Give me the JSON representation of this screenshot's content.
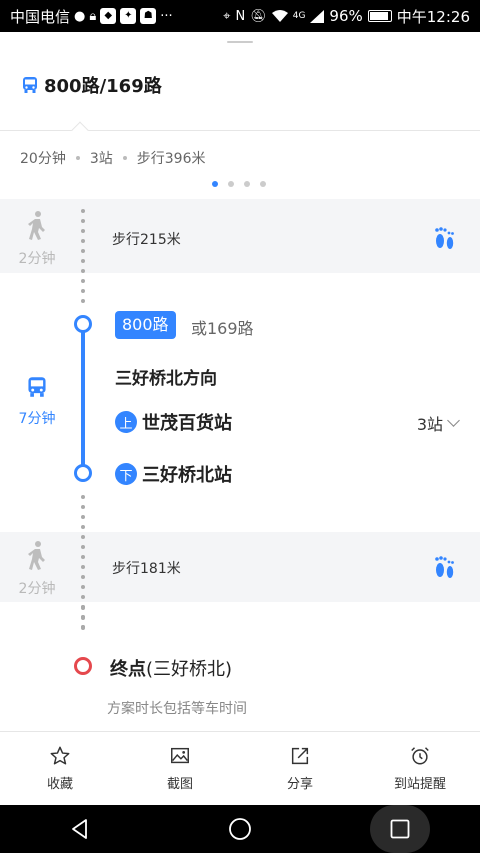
{
  "status_bar": {
    "carrier": "中国电信",
    "battery": "96%",
    "time": "中午12:26",
    "left_icons": [
      "chat-icon",
      "lock-icon",
      "app-icon",
      "app-icon",
      "android-icon",
      "more-icon"
    ],
    "more": "···",
    "right_icons": [
      "location-icon",
      "nfc-icon",
      "mute-icon",
      "wifi-icon",
      "signal-icon",
      "battery-icon"
    ],
    "network": "4G"
  },
  "route": {
    "title": "800路/169路",
    "duration": "20分钟",
    "stations": "3站",
    "walk_total": "步行396米"
  },
  "pager": {
    "count": 4,
    "active": 0
  },
  "walk1": {
    "time": "2分钟",
    "text": "步行215米"
  },
  "bus": {
    "time": "7分钟",
    "line": "800路",
    "alt_line": "或169路",
    "direction": "三好桥北方向",
    "board_badge": "上",
    "board_stop": "世茂百货站",
    "stops_count": "3站",
    "alight_badge": "下",
    "alight_stop": "三好桥北站"
  },
  "walk2": {
    "time": "2分钟",
    "text": "步行181米"
  },
  "end": {
    "label": "终点",
    "place": "(三好桥北)",
    "note": "方案时长包括等车时间"
  },
  "toolbar": {
    "favorite": "收藏",
    "screenshot": "截图",
    "share": "分享",
    "remind": "到站提醒"
  },
  "colors": {
    "accent": "#3385ff",
    "end": "#e5484d",
    "walk_band": "#f4f5f7"
  }
}
